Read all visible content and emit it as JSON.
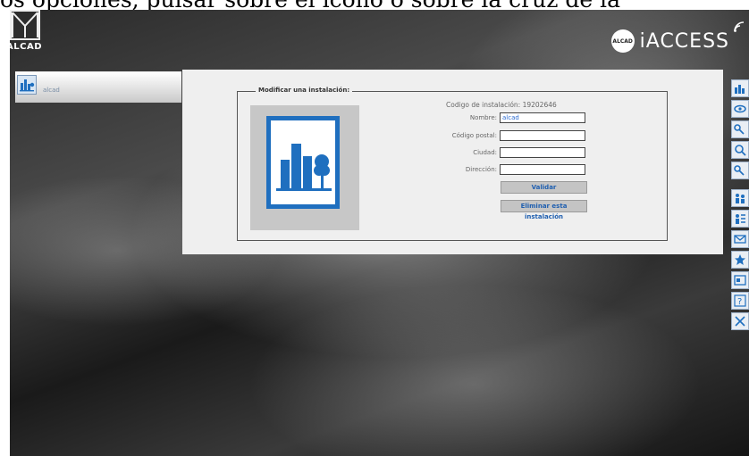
{
  "caption": "os opciones, pulsar sobre el icono o sobre la cruz de la ",
  "header": {
    "logo_text": "ALCAD",
    "brand_badge": "ALCAD",
    "brand_name": "iACCESS"
  },
  "sidebar": {
    "items": [
      {
        "label": "alcad"
      }
    ]
  },
  "form": {
    "legend": "Modificar una instalación:",
    "code_label": "Codigo de instalación: 19202646",
    "fields": [
      {
        "label": "Nombre:",
        "value": "alcad"
      },
      {
        "label": "Código postal:",
        "value": ""
      },
      {
        "label": "Ciudad:",
        "value": ""
      },
      {
        "label": "Dirección:",
        "value": ""
      }
    ],
    "validate_label": "Validar",
    "delete_label": "Eliminar esta instalación"
  },
  "right_toolbar": {
    "icons": [
      "chart-icon",
      "eye-icon",
      "key-add-icon",
      "search-icon",
      "key-remove-icon",
      "users-add-icon",
      "users-list-icon",
      "mail-icon",
      "star-icon",
      "card-icon",
      "help-icon",
      "close-icon"
    ]
  },
  "colors": {
    "accent": "#1f6fbf",
    "button_text": "#1f5fb0"
  }
}
